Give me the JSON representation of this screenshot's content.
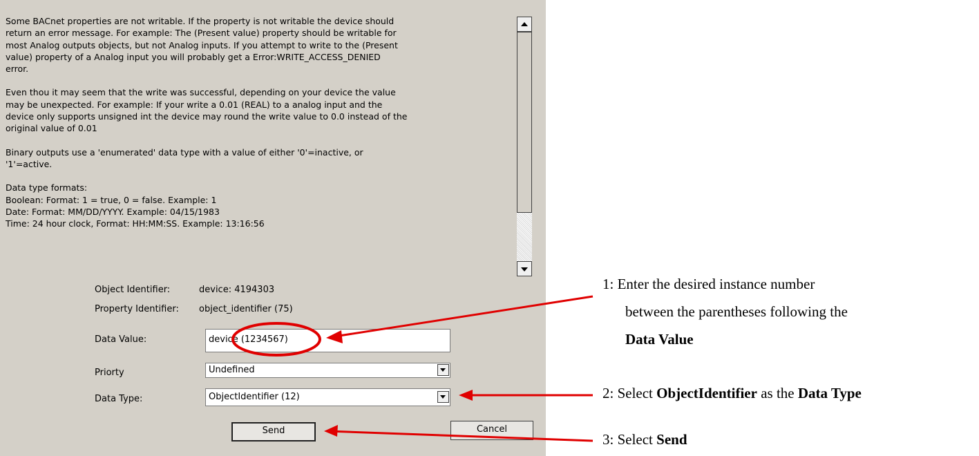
{
  "help": {
    "paragraphs": [
      [
        "Some BACnet properties are not writable. If the property is not writable the device should",
        "return an error message. For example: The (Present value) property should be writable for",
        "most Analog outputs objects, but not Analog inputs. If you attempt to write to the (Present",
        "value) property of a Analog input you will probably get a Error:WRITE_ACCESS_DENIED",
        "error."
      ],
      [
        "Even thou it may seem that the write was successful, depending on your device the value",
        "may be unexpected. For example: If your write a 0.01 (REAL) to a analog input and the",
        "device only supports unsigned int the device may round the write value to 0.0 instead of the",
        "original value of 0.01"
      ],
      [
        "Binary outputs use a 'enumerated' data type with a value of either '0'=inactive, or",
        "'1'=active."
      ],
      [
        "Data type formats:",
        "Boolean: Format: 1 = true, 0 = false. Example: 1",
        "Date: Format: MM/DD/YYYY. Example: 04/15/1983",
        "Time: 24 hour clock, Format: HH:MM:SS. Example: 13:16:56"
      ]
    ]
  },
  "form": {
    "object_identifier_label": "Object Identifier:",
    "object_identifier_value": "device: 4194303",
    "property_identifier_label": "Property Identifier:",
    "property_identifier_value": "object_identifier (75)",
    "data_value_label": "Data Value:",
    "data_value": "device (1234567)",
    "priority_label": "Priorty",
    "priority_value": "Undefined",
    "data_type_label": "Data Type:",
    "data_type_value": "ObjectIdentifier (12)",
    "send_label": "Send",
    "cancel_label": "Cancel"
  },
  "callouts": {
    "step1": {
      "prefix": "1:  Enter the desired instance number",
      "line2": "between the parentheses following the",
      "bold": "Data Value"
    },
    "step2": {
      "prefix": "2:  Select ",
      "bold1": "ObjectIdentifier",
      "middle": " as the ",
      "bold2": "Data Type"
    },
    "step3": {
      "prefix": "3: Select ",
      "bold": "Send"
    }
  },
  "colors": {
    "dialog_bg": "#d4d0c8",
    "annotation_red": "#e00000"
  }
}
